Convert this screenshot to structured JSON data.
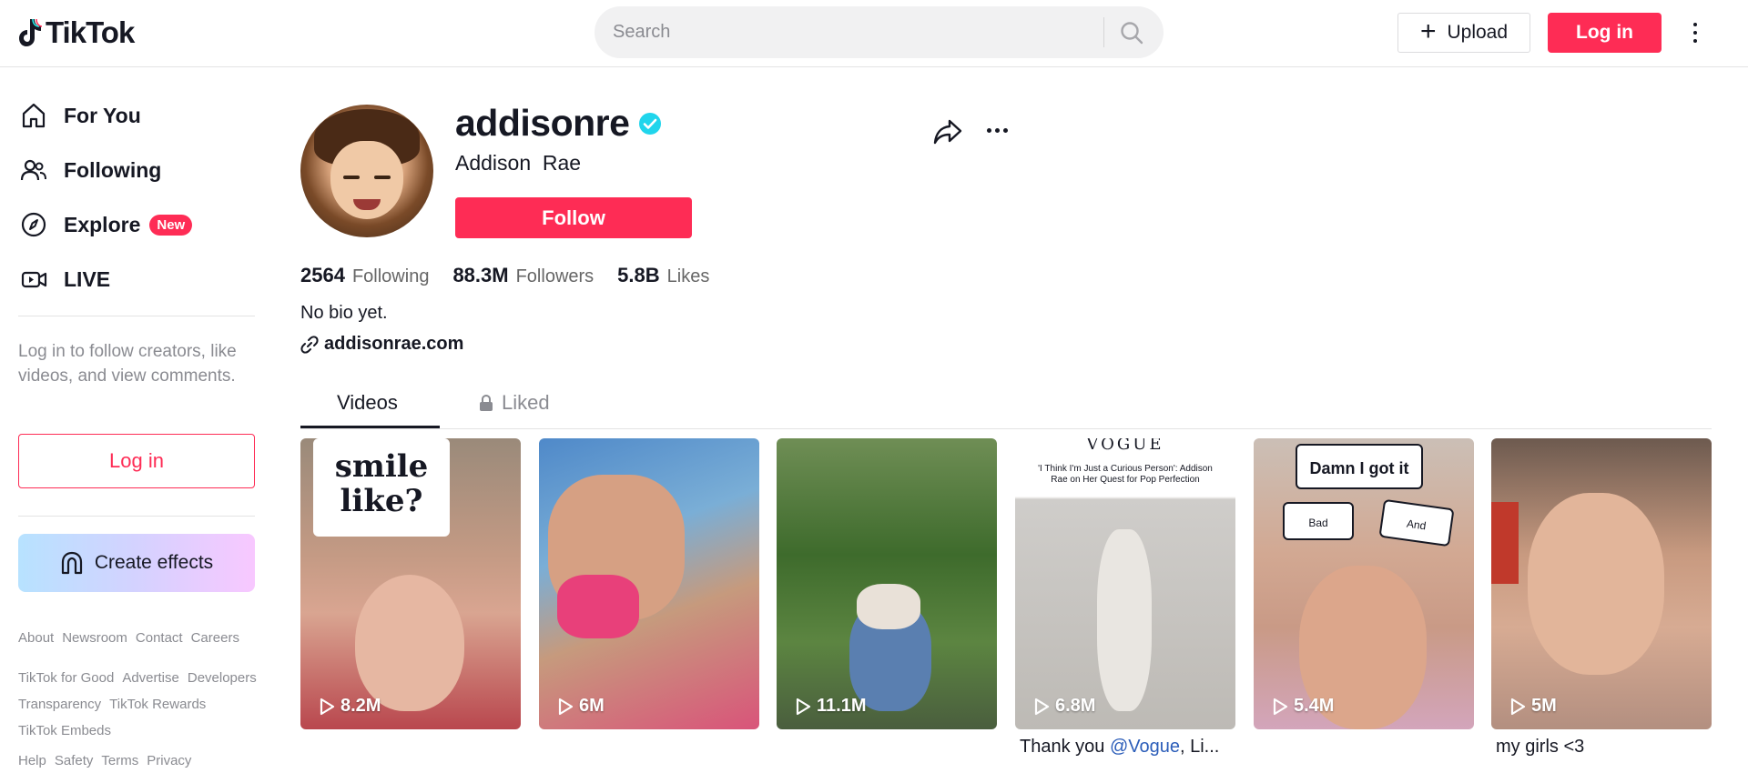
{
  "header": {
    "logo_text": "TikTok",
    "search_placeholder": "Search",
    "upload_label": "Upload",
    "login_label": "Log in"
  },
  "sidebar": {
    "nav": [
      {
        "label": "For You",
        "icon": "home-icon"
      },
      {
        "label": "Following",
        "icon": "people-icon"
      },
      {
        "label": "Explore",
        "icon": "compass-icon",
        "badge": "New"
      },
      {
        "label": "LIVE",
        "icon": "live-icon"
      }
    ],
    "login_hint": "Log in to follow creators, like videos, and view comments.",
    "login_label": "Log in",
    "effects_label": "Create effects",
    "footer_row1": [
      "About",
      "Newsroom",
      "Contact",
      "Careers"
    ],
    "footer_row2": [
      "TikTok for Good",
      "Advertise",
      "Developers",
      "Transparency",
      "TikTok Rewards",
      "TikTok Embeds"
    ],
    "footer_row3": [
      "Help",
      "Safety",
      "Terms",
      "Privacy"
    ]
  },
  "profile": {
    "username": "addisonre",
    "nickname": "Addison  Rae",
    "follow_label": "Follow",
    "stats": {
      "following_count": "2564",
      "following_label": "Following",
      "followers_count": "88.3M",
      "followers_label": "Followers",
      "likes_count": "5.8B",
      "likes_label": "Likes"
    },
    "bio": "No bio yet.",
    "link": "addisonrae.com"
  },
  "tabs": {
    "videos": "Videos",
    "liked": "Liked"
  },
  "videos": [
    {
      "views": "8.2M",
      "overlay": "smile like?"
    },
    {
      "views": "6M"
    },
    {
      "views": "11.1M"
    },
    {
      "views": "6.8M",
      "overlay_brand": "VOGUE",
      "overlay_headline": "'I Think I'm Just a Curious Person': Addison Rae on Her Quest for Pop Perfection",
      "caption_prefix": "Thank you ",
      "caption_mention": "@Vogue",
      "caption_suffix": ", Li..."
    },
    {
      "views": "5.4M",
      "overlay": "Damn I got it",
      "opt1": "Bad",
      "opt2": "And"
    },
    {
      "views": "5M",
      "caption": "my girls <3"
    }
  ],
  "colors": {
    "brand": "#fe2c55",
    "verified": "#20d5ec",
    "text": "#161823",
    "muted": "#8a8b91"
  }
}
